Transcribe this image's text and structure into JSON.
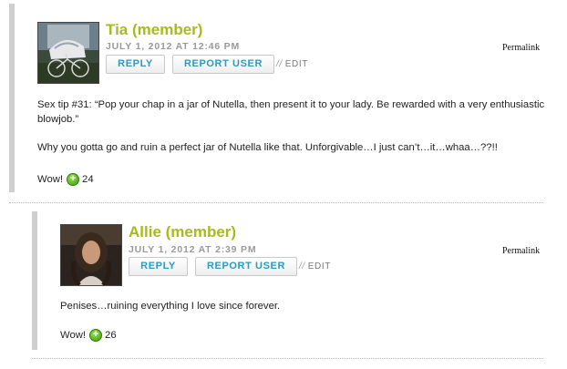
{
  "comments": [
    {
      "author": "Tia (member)",
      "date": "JULY 1, 2012 AT 12:46 PM",
      "reply_label": "REPLY",
      "report_label": "REPORT USER",
      "edit_label": "EDIT",
      "edit_sep": "//",
      "permalink": "Permalink",
      "paragraphs": [
        "Sex tip #31: “Pop your chap in a jar of Nutella, then present it to your lady. Be rewarded with a very enthusiastic blowjob.”",
        "Why you gotta go and ruin a perfect jar of Nutella like that. Unforgivable…I just can’t…it…whaa…??!!"
      ],
      "vote_label": "Wow!",
      "vote_count": "24"
    },
    {
      "author": "Allie (member)",
      "date": "JULY 1, 2012 AT 2:39 PM",
      "reply_label": "REPLY",
      "report_label": "REPORT USER",
      "edit_label": "EDIT",
      "edit_sep": "//",
      "permalink": "Permalink",
      "paragraphs": [
        "Penises…ruining everything I love since forever."
      ],
      "vote_label": "Wow!",
      "vote_count": "26"
    }
  ],
  "icons": {
    "vote": "plus-circle-icon"
  },
  "colors": {
    "author": "#a6bb1d",
    "button_text": "#2a9cc0",
    "vote_icon": "#4caf1a",
    "thread_bar": "#cfcfcf"
  }
}
